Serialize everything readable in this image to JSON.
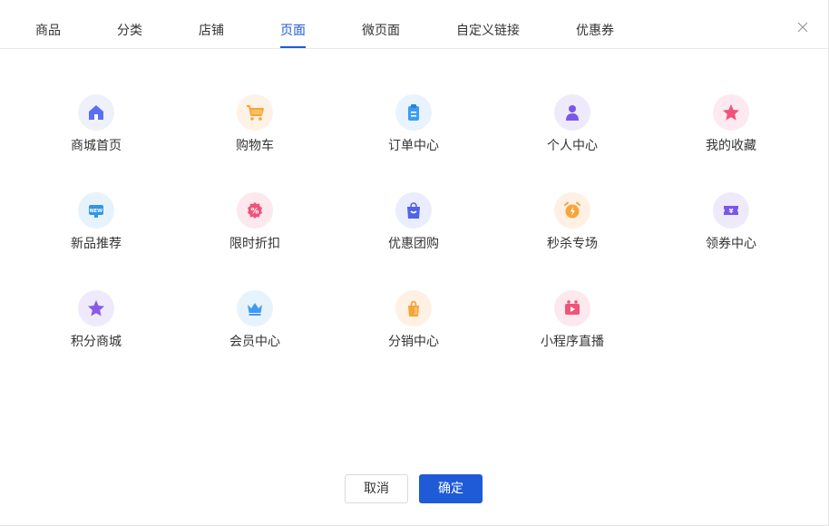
{
  "tabs": [
    {
      "label": "商品"
    },
    {
      "label": "分类"
    },
    {
      "label": "店铺"
    },
    {
      "label": "页面"
    },
    {
      "label": "微页面"
    },
    {
      "label": "自定义链接"
    },
    {
      "label": "优惠券"
    }
  ],
  "active_tab": "页面",
  "pages": [
    {
      "label": "商城首页",
      "icon": "home-icon"
    },
    {
      "label": "购物车",
      "icon": "cart-icon"
    },
    {
      "label": "订单中心",
      "icon": "order-clipboard-icon"
    },
    {
      "label": "个人中心",
      "icon": "person-icon"
    },
    {
      "label": "我的收藏",
      "icon": "star-favorite-icon"
    },
    {
      "label": "新品推荐",
      "icon": "new-badge-icon"
    },
    {
      "label": "限时折扣",
      "icon": "discount-percent-icon"
    },
    {
      "label": "优惠团购",
      "icon": "shopping-bag-icon"
    },
    {
      "label": "秒杀专场",
      "icon": "alarm-clock-icon"
    },
    {
      "label": "领券中心",
      "icon": "coupon-ticket-icon"
    },
    {
      "label": "积分商城",
      "icon": "points-star-icon"
    },
    {
      "label": "会员中心",
      "icon": "crown-icon"
    },
    {
      "label": "分销中心",
      "icon": "distribution-bag-icon"
    },
    {
      "label": "小程序直播",
      "icon": "live-video-icon"
    }
  ],
  "footer": {
    "cancel_label": "取消",
    "ok_label": "确定"
  },
  "colors": {
    "accent": "#1f5bd6"
  }
}
